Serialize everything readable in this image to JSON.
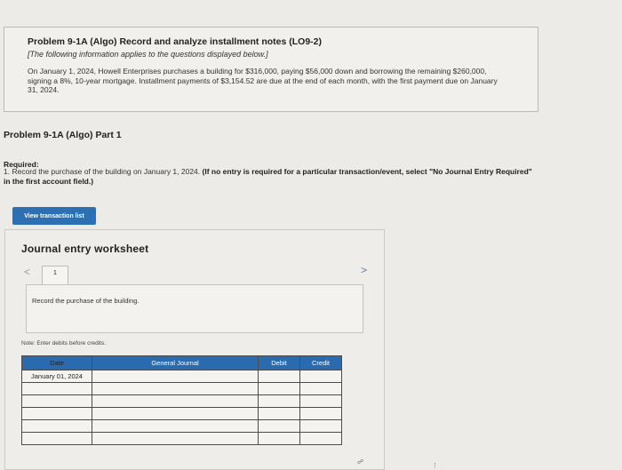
{
  "problem": {
    "title": "Problem 9-1A (Algo) Record and analyze installment notes (LO9-2)",
    "note": "[The following information applies to the questions displayed below.]",
    "description": "On January 1, 2024, Howell Enterprises purchases a building for $316,000, paying $56,000 down and borrowing the remaining $260,000, signing a 8%, 10-year mortgage. Installment payments of $3,154.52 are due at the end of each month, with the first payment due on January 31, 2024."
  },
  "part": {
    "title": "Problem 9-1A (Algo) Part 1"
  },
  "required": {
    "label": "Required:",
    "text": "1. Record the purchase of the building on January 1, 2024.",
    "bold_text": "(If no entry is required for a particular transaction/event, select \"No Journal Entry Required\" in the first account field.)"
  },
  "buttons": {
    "view_transaction_list": "View transaction list"
  },
  "worksheet": {
    "title": "Journal entry worksheet",
    "prev_icon": "chevron-left-icon",
    "next_icon": "chevron-right-icon",
    "prev_glyph": "<",
    "next_glyph": ">",
    "tab_label": "1",
    "instruction": "Record the purchase of the building.",
    "note": "Note: Enter debits before credits.",
    "columns": {
      "date": "Date",
      "general_journal": "General Journal",
      "debit": "Debit",
      "credit": "Credit"
    },
    "rows": [
      {
        "date": "January 01, 2024",
        "account": "",
        "debit": "",
        "credit": ""
      },
      {
        "date": "",
        "account": "",
        "debit": "",
        "credit": ""
      },
      {
        "date": "",
        "account": "",
        "debit": "",
        "credit": ""
      },
      {
        "date": "",
        "account": "",
        "debit": "",
        "credit": ""
      },
      {
        "date": "",
        "account": "",
        "debit": "",
        "credit": ""
      },
      {
        "date": "",
        "account": "",
        "debit": "",
        "credit": ""
      }
    ]
  },
  "colors": {
    "button_blue": "#2d6fb3",
    "header_blue": "#2a6bb0",
    "background": "#ecebe8"
  }
}
